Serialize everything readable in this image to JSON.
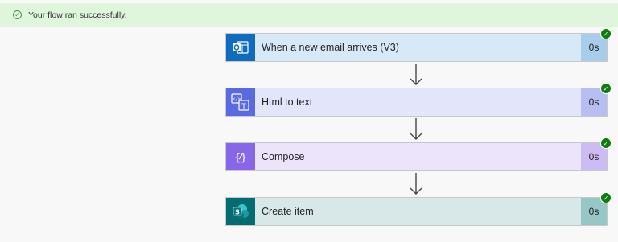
{
  "banner": {
    "message": "Your flow ran successfully."
  },
  "steps": [
    {
      "title": "When a new email arrives (V3)",
      "duration": "0s",
      "icon": "outlook-icon",
      "bg": "#d7e9f7",
      "icon_bg": "#0f6cbd",
      "dur_bg": "#a7cdea"
    },
    {
      "title": "Html to text",
      "duration": "0s",
      "icon": "html-to-text-icon",
      "bg": "#e3e6fb",
      "icon_bg": "#5a6ae0",
      "dur_bg": "#b7bef1"
    },
    {
      "title": "Compose",
      "duration": "0s",
      "icon": "compose-icon",
      "bg": "#ebe4fb",
      "icon_bg": "#8766e8",
      "dur_bg": "#cdbcf3"
    },
    {
      "title": "Create item",
      "duration": "0s",
      "icon": "sharepoint-icon",
      "bg": "#d8e8e8",
      "icon_bg": "#036c70",
      "dur_bg": "#97c6c6"
    }
  ]
}
